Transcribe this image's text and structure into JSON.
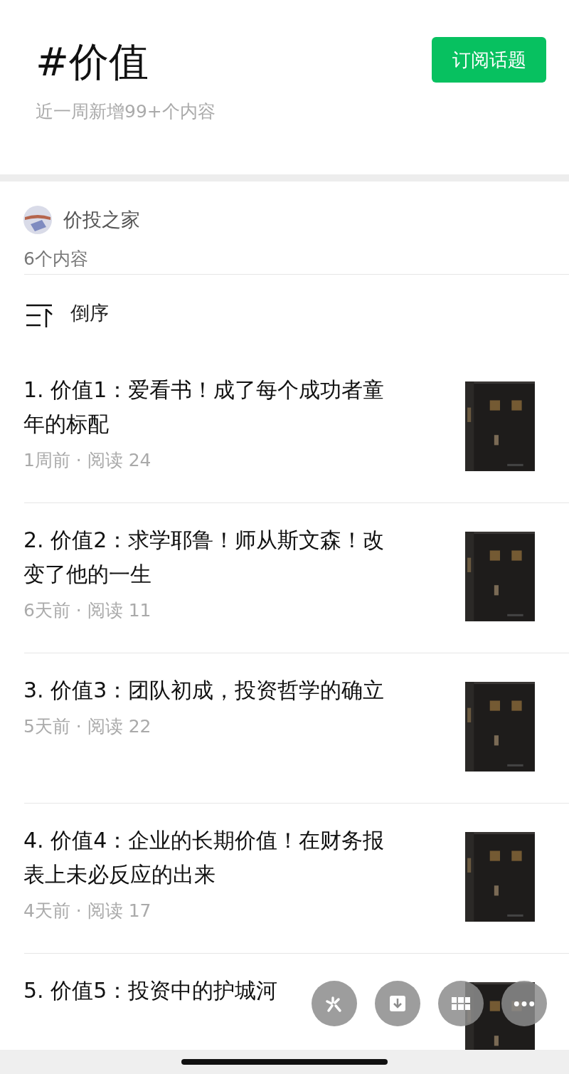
{
  "header": {
    "title": "#价值",
    "subtitle": "近一周新增99+个内容",
    "subscribe_button": "订阅话题"
  },
  "author": {
    "name": "价投之家",
    "count": "6个内容"
  },
  "sort": {
    "label": "倒序"
  },
  "articles": [
    {
      "title": "1. 价值1：爱看书！成了每个成功者童年的标配",
      "meta": "1周前 · 阅读 24",
      "kind": "picture"
    },
    {
      "title": "2. 价值2：求学耶鲁！师从斯文森！改变了他的一生",
      "meta": "6天前 · 阅读 11",
      "kind": "picture"
    },
    {
      "title": "3. 价值3：团队初成，投资哲学的确立",
      "meta": "5天前 · 阅读 22",
      "kind": "picture"
    },
    {
      "title": "4. 价值4：企业的长期价值！在财务报表上未必反应的出来",
      "meta": "4天前 · 阅读 17",
      "kind": "picture"
    },
    {
      "title": "5. 价值5：投资中的护城河",
      "kind": "picture"
    }
  ]
}
